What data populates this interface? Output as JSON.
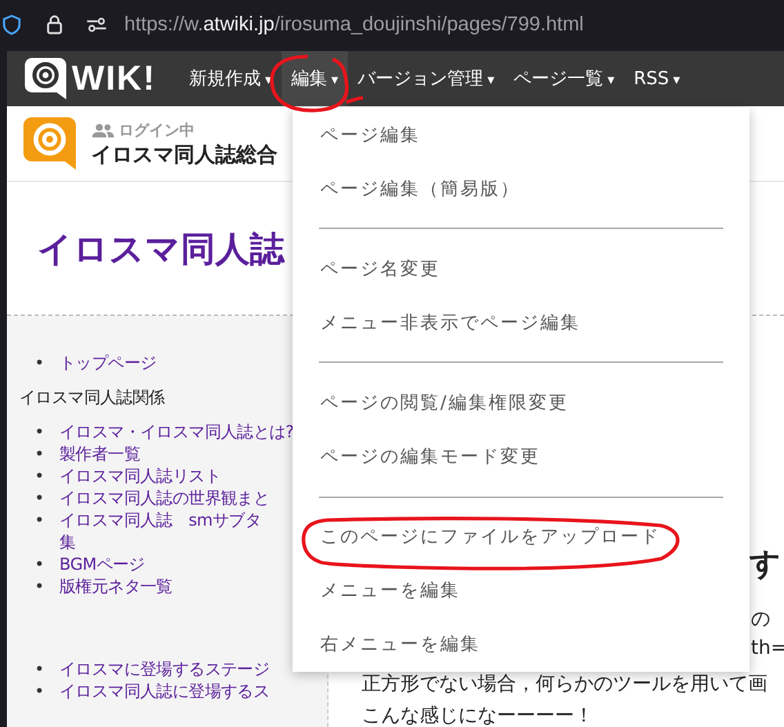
{
  "browser": {
    "url_scheme": "https://w.",
    "url_domain": "atwiki.jp",
    "url_path": "/irosuma_doujinshi/pages/799.html"
  },
  "nav": {
    "logo": "WIK!",
    "items": [
      {
        "label": "新規作成",
        "caret": "▾",
        "selected": false
      },
      {
        "label": "編集",
        "caret": "▾",
        "selected": true
      },
      {
        "label": "バージョン管理",
        "caret": "▾",
        "selected": false
      },
      {
        "label": "ページ一覧",
        "caret": "▾",
        "selected": false
      },
      {
        "label": "RSS",
        "caret": "▾",
        "selected": false
      }
    ]
  },
  "header": {
    "login_status": "ログイン中",
    "site_title": "イロスマ同人誌総合"
  },
  "page_title": "イロスマ同人誌",
  "sidebar": {
    "bullet": "•",
    "sections": [
      {
        "items": [
          [
            "トップページ"
          ]
        ]
      },
      {
        "heading": "イロスマ同人誌関係",
        "items": [
          [
            "イロスマ・イロスマ同人誌とは?"
          ],
          [
            "製作者一覧"
          ],
          [
            "イロスマ同人誌リスト"
          ],
          [
            "イロスマ同人誌の世界観まと"
          ],
          [
            "イロスマ同人誌　smサブタ",
            "集"
          ],
          [
            "BGMページ"
          ],
          [
            "版権元ネタ一覧"
          ]
        ]
      },
      {
        "items": [
          [
            "イロスマに登場するステージ"
          ],
          [
            "イロスマ同人誌に登場するス"
          ]
        ]
      }
    ]
  },
  "dropdown": {
    "groups": [
      [
        "ページ編集",
        "ページ編集（簡易版）"
      ],
      [
        "ページ名変更",
        "メニュー非表示でページ編集"
      ],
      [
        "ページの閲覧/編集権限変更",
        "ページの編集モード変更"
      ],
      [
        "このページにファイルをアップロード",
        "メニューを編集",
        "右メニューを編集"
      ]
    ]
  },
  "main": {
    "heading_fragment": "す",
    "fragments": [
      "の",
      "th="
    ],
    "lines": [
      "正方形でない場合，何らかのツールを用いて画",
      "こんな感じになーーーー！"
    ]
  }
}
